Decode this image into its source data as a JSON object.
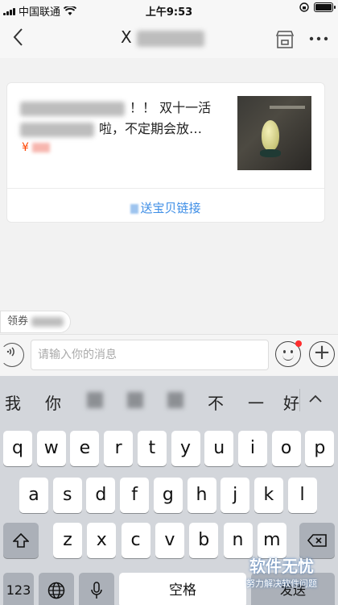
{
  "status_bar": {
    "carrier": "中国联通",
    "time": "上午9:53",
    "battery_level": 1.0
  },
  "nav": {
    "back_icon": "chevron-left-icon",
    "title_visible": "X"
  },
  "card": {
    "title": "！！ 双十一活",
    "title_line2": "啦，不定期会放…",
    "price_symbol": "¥",
    "action": "送宝贝链接"
  },
  "chip": {
    "label": "领券"
  },
  "input": {
    "placeholder": "请输入你的消息"
  },
  "keyboard": {
    "candidates": [
      "我",
      "你",
      "不",
      "一",
      "好"
    ],
    "row1": [
      "q",
      "w",
      "e",
      "r",
      "t",
      "y",
      "u",
      "i",
      "o",
      "p"
    ],
    "row2": [
      "a",
      "s",
      "d",
      "f",
      "g",
      "h",
      "j",
      "k",
      "l"
    ],
    "row3": [
      "z",
      "x",
      "c",
      "v",
      "b",
      "n",
      "m"
    ],
    "numbers_label": "123",
    "space_label": "空格",
    "send_label": "发送"
  },
  "watermark": {
    "title": "软件无忧",
    "subtitle": "努力解决软件问题"
  },
  "colors": {
    "accent_link": "#3c8de6",
    "price": "#ff4400",
    "badge": "#ff2d2d"
  }
}
